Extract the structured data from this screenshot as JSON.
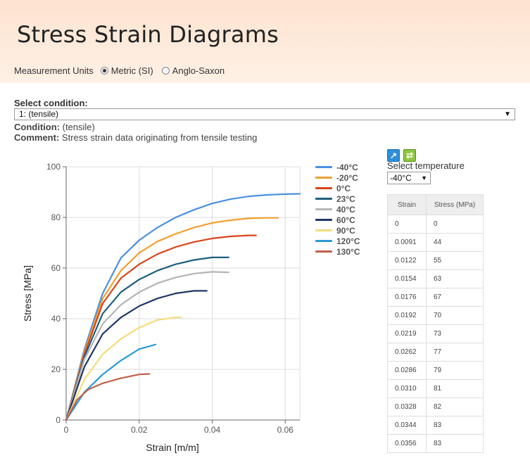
{
  "header": {
    "title": "Stress Strain Diagrams",
    "units_label": "Measurement Units",
    "unit_options": [
      "Metric (SI)",
      "Anglo-Saxon"
    ],
    "unit_selected": "Metric (SI)"
  },
  "condition_select": {
    "label": "Select condition:",
    "value": "1: (tensile)"
  },
  "condition": {
    "label": "Condition:",
    "value": "(tensile)"
  },
  "comment": {
    "label": "Comment:",
    "value": "Stress strain data originating from tensile testing"
  },
  "temperature_select": {
    "label": "Select temperature",
    "value": "-40°C"
  },
  "table": {
    "headers": [
      "Strain",
      "Stress (MPa)"
    ],
    "rows": [
      [
        "0",
        "0"
      ],
      [
        "0.0091",
        "44"
      ],
      [
        "0.0122",
        "55"
      ],
      [
        "0.0154",
        "63"
      ],
      [
        "0.0176",
        "67"
      ],
      [
        "0.0192",
        "70"
      ],
      [
        "0.0219",
        "73"
      ],
      [
        "0.0262",
        "77"
      ],
      [
        "0.0286",
        "79"
      ],
      [
        "0.0310",
        "81"
      ],
      [
        "0.0328",
        "82"
      ],
      [
        "0.0344",
        "83"
      ],
      [
        "0.0356",
        "83"
      ]
    ]
  },
  "chart_data": {
    "type": "line",
    "xlabel": "Strain [m/m]",
    "ylabel": "Stress [MPa]",
    "xlim": [
      0,
      0.064
    ],
    "ylim": [
      0,
      100
    ],
    "xticks": [
      "0",
      "0.02",
      "0.04",
      "0.06"
    ],
    "yticks": [
      "0",
      "20",
      "40",
      "60",
      "80",
      "100"
    ],
    "grid": true,
    "legend_position": "right",
    "series": [
      {
        "name": "-40°C",
        "color": "#4a90e2",
        "x": [
          0,
          0.005,
          0.01,
          0.015,
          0.02,
          0.025,
          0.03,
          0.035,
          0.04,
          0.045,
          0.05,
          0.055,
          0.06,
          0.064
        ],
        "y": [
          0,
          28,
          50,
          64,
          71,
          76,
          80,
          83,
          85.5,
          87.2,
          88.3,
          88.9,
          89.2,
          89.3
        ]
      },
      {
        "name": "-20°C",
        "color": "#f0a030",
        "x": [
          0,
          0.005,
          0.01,
          0.015,
          0.02,
          0.025,
          0.03,
          0.035,
          0.04,
          0.045,
          0.05,
          0.055,
          0.058
        ],
        "y": [
          0,
          27,
          48,
          59,
          66,
          70.5,
          73.5,
          76,
          77.8,
          78.9,
          79.6,
          79.8,
          79.8
        ]
      },
      {
        "name": "0°C",
        "color": "#d9441a",
        "x": [
          0,
          0.005,
          0.01,
          0.015,
          0.02,
          0.025,
          0.03,
          0.035,
          0.04,
          0.045,
          0.05,
          0.052
        ],
        "y": [
          0,
          26,
          46,
          56,
          61.5,
          65.5,
          68.3,
          70.3,
          71.7,
          72.5,
          72.9,
          72.9
        ]
      },
      {
        "name": "23°C",
        "color": "#1e5f7a",
        "x": [
          0,
          0.005,
          0.01,
          0.015,
          0.02,
          0.025,
          0.03,
          0.035,
          0.04,
          0.0445
        ],
        "y": [
          0,
          25,
          42,
          50.5,
          55.5,
          59,
          61.5,
          63.2,
          64.2,
          64.2
        ]
      },
      {
        "name": "40°C",
        "color": "#b5b5b5",
        "x": [
          0,
          0.005,
          0.01,
          0.015,
          0.02,
          0.025,
          0.03,
          0.035,
          0.04,
          0.0445
        ],
        "y": [
          0,
          24,
          38,
          45.5,
          50.5,
          54,
          56.3,
          57.8,
          58.5,
          58.3
        ]
      },
      {
        "name": "60°C",
        "color": "#1f3566",
        "x": [
          0,
          0.005,
          0.01,
          0.015,
          0.02,
          0.025,
          0.03,
          0.035,
          0.0385
        ],
        "y": [
          0,
          21,
          34,
          40.5,
          45,
          48,
          50,
          51,
          51
        ]
      },
      {
        "name": "90°C",
        "color": "#f5dc7a",
        "x": [
          0,
          0.005,
          0.01,
          0.015,
          0.02,
          0.025,
          0.03,
          0.0315
        ],
        "y": [
          0,
          16,
          26,
          32,
          36.5,
          39.5,
          40.5,
          40.5
        ]
      },
      {
        "name": "120°C",
        "color": "#2a9ad6",
        "x": [
          0,
          0.005,
          0.01,
          0.015,
          0.02,
          0.0245
        ],
        "y": [
          0,
          11,
          18,
          23.5,
          28,
          29.8
        ]
      },
      {
        "name": "130°C",
        "color": "#c0604a",
        "x": [
          0,
          0.003,
          0.006,
          0.01,
          0.015,
          0.02,
          0.0228
        ],
        "y": [
          0,
          8,
          12,
          14.5,
          16.5,
          18,
          18.2
        ]
      }
    ]
  }
}
